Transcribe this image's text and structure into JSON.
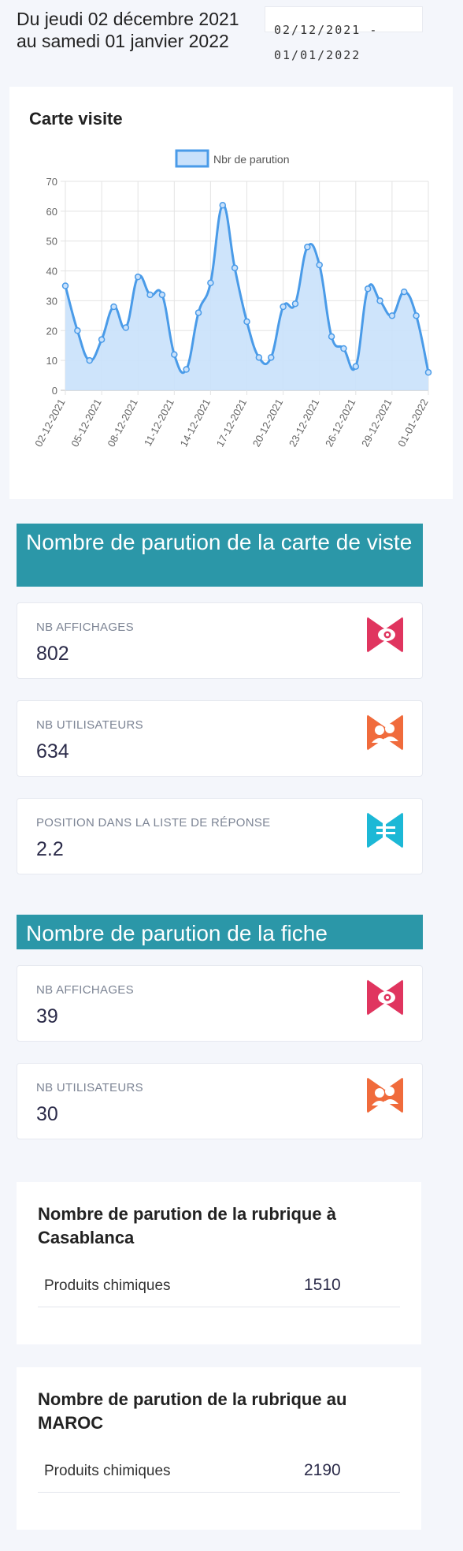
{
  "header": {
    "period_text": "Du jeudi 02 décembre 2021 au samedi 01 janvier 2022",
    "date_range_text": "02/12/2021 - 01/01/2022"
  },
  "chart_card": {
    "title": "Carte visite"
  },
  "chart_data": {
    "type": "area",
    "legend": [
      "Nbr de parution"
    ],
    "legend_position": "top-center",
    "ylim": [
      0,
      70
    ],
    "y_ticks": [
      0,
      10,
      20,
      30,
      40,
      50,
      60,
      70
    ],
    "x_tick_labels": [
      "02-12-2021",
      "05-12-2021",
      "08-12-2021",
      "11-12-2021",
      "14-12-2021",
      "17-12-2021",
      "20-12-2021",
      "23-12-2021",
      "26-12-2021",
      "29-12-2021",
      "01-01-2022"
    ],
    "x": [
      "02-12-2021",
      "03-12-2021",
      "04-12-2021",
      "05-12-2021",
      "06-12-2021",
      "07-12-2021",
      "08-12-2021",
      "09-12-2021",
      "10-12-2021",
      "11-12-2021",
      "12-12-2021",
      "13-12-2021",
      "14-12-2021",
      "15-12-2021",
      "16-12-2021",
      "17-12-2021",
      "18-12-2021",
      "19-12-2021",
      "20-12-2021",
      "21-12-2021",
      "22-12-2021",
      "23-12-2021",
      "24-12-2021",
      "25-12-2021",
      "26-12-2021",
      "27-12-2021",
      "28-12-2021",
      "29-12-2021",
      "30-12-2021",
      "31-12-2021",
      "01-01-2022"
    ],
    "series": [
      {
        "name": "Nbr de parution",
        "color": "#4a9be8",
        "fill": "#c9e1fb",
        "values": [
          35,
          20,
          10,
          17,
          28,
          21,
          38,
          32,
          32,
          12,
          7,
          26,
          36,
          62,
          41,
          23,
          11,
          11,
          28,
          29,
          48,
          42,
          18,
          14,
          8,
          34,
          30,
          25,
          33,
          25,
          6
        ]
      }
    ],
    "grid": true
  },
  "section1": {
    "title": "Nombre de parution de la carte de viste",
    "cards": [
      {
        "label": "NB AFFICHAGES",
        "value": "802",
        "icon": "eye-icon"
      },
      {
        "label": "NB UTILISATEURS",
        "value": "634",
        "icon": "users-icon"
      },
      {
        "label": "POSITION DANS LA LISTE DE RÉPONSE",
        "value": "2.2",
        "icon": "list-position-icon"
      }
    ]
  },
  "section2": {
    "title": "Nombre de parution de la fiche",
    "cards": [
      {
        "label": "NB AFFICHAGES",
        "value": "39",
        "icon": "eye-icon"
      },
      {
        "label": "NB UTILISATEURS",
        "value": "30",
        "icon": "users-icon"
      }
    ]
  },
  "rubrique_casablanca": {
    "title": "Nombre de parution de la rubrique à Casablanca",
    "rows": [
      {
        "name": "Produits chimiques",
        "value": "1510"
      }
    ]
  },
  "rubrique_maroc": {
    "title": "Nombre de parution de la rubrique au MAROC",
    "rows": [
      {
        "name": "Produits chimiques",
        "value": "2190"
      }
    ]
  },
  "colors": {
    "section_header": "#2b97a8",
    "eye_icon": "#e0355f",
    "users_icon": "#f06b3c",
    "list_icon": "#1cb8d6"
  }
}
